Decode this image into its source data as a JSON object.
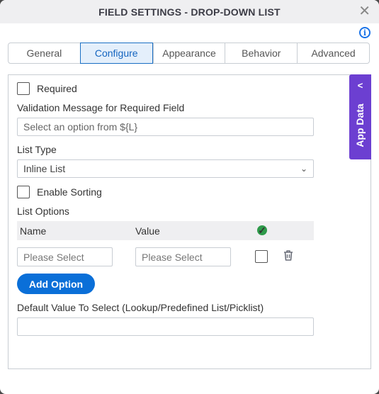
{
  "dialog": {
    "title": "FIELD SETTINGS - DROP-DOWN LIST",
    "close_icon": "close-icon",
    "info_icon": "info-icon"
  },
  "tabs": [
    {
      "label": "General",
      "active": false
    },
    {
      "label": "Configure",
      "active": true
    },
    {
      "label": "Appearance",
      "active": false
    },
    {
      "label": "Behavior",
      "active": false
    },
    {
      "label": "Advanced",
      "active": false
    }
  ],
  "app_data": {
    "label": "App Data",
    "icon": "chevron-left-icon",
    "accent": "#6c3fd1"
  },
  "form": {
    "required": {
      "label": "Required",
      "checked": false
    },
    "validation_message": {
      "label": "Validation Message for Required Field",
      "placeholder": "Select an option from ${L}",
      "value": ""
    },
    "list_type": {
      "label": "List Type",
      "selected": "Inline List"
    },
    "enable_sorting": {
      "label": "Enable Sorting",
      "checked": false
    },
    "list_options": {
      "label": "List Options",
      "columns": [
        "Name",
        "Value"
      ],
      "default_column_icon": "check-circle-icon",
      "rows": [
        {
          "name_placeholder": "Please Select",
          "value_placeholder": "Please Select",
          "default": false
        }
      ],
      "add_button": "Add Option"
    },
    "default_value": {
      "label": "Default Value To Select (Lookup/Predefined List/Picklist)",
      "value": ""
    }
  },
  "colors": {
    "primary": "#0a6fd8",
    "success": "#2e9a4a",
    "title_bar": "#efeff1"
  }
}
